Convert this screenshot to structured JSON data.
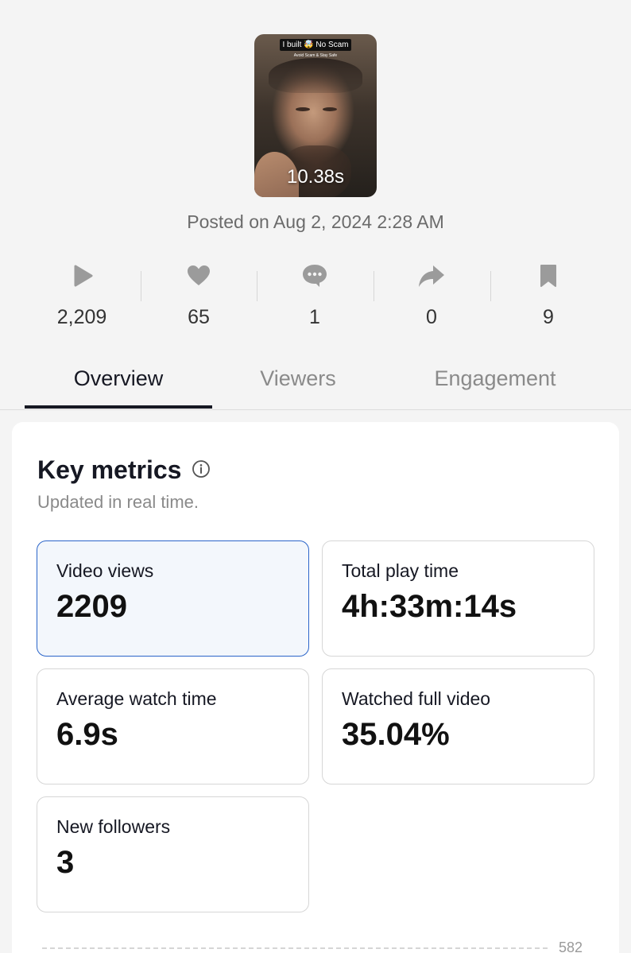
{
  "video": {
    "caption": "I built 🤯 No Scam",
    "subcaption": "Avoid Scam & Stay Safe",
    "duration": "10.38s",
    "posted": "Posted on Aug 2, 2024 2:28 AM"
  },
  "stats": [
    {
      "icon": "play-icon",
      "value": "2,209"
    },
    {
      "icon": "heart-icon",
      "value": "65"
    },
    {
      "icon": "comment-icon",
      "value": "1"
    },
    {
      "icon": "share-icon",
      "value": "0"
    },
    {
      "icon": "bookmark-icon",
      "value": "9"
    }
  ],
  "tabs": [
    {
      "label": "Overview",
      "active": true
    },
    {
      "label": "Viewers",
      "active": false
    },
    {
      "label": "Engagement",
      "active": false
    }
  ],
  "key_metrics": {
    "title": "Key metrics",
    "subtitle": "Updated in real time.",
    "metrics": [
      {
        "label": "Video views",
        "value": "2209",
        "selected": true
      },
      {
        "label": "Total play time",
        "value": "4h:33m:14s",
        "selected": false
      },
      {
        "label": "Average watch time",
        "value": "6.9s",
        "selected": false
      },
      {
        "label": "Watched full video",
        "value": "35.04%",
        "selected": false
      },
      {
        "label": "New followers",
        "value": "3",
        "selected": false
      }
    ]
  },
  "chart": {
    "top_tick": "582"
  },
  "colors": {
    "background": "#f4f4f4",
    "selected_border": "#2b65c9",
    "selected_fill": "#f3f7fc",
    "icon_gray": "#9b9b9b"
  }
}
